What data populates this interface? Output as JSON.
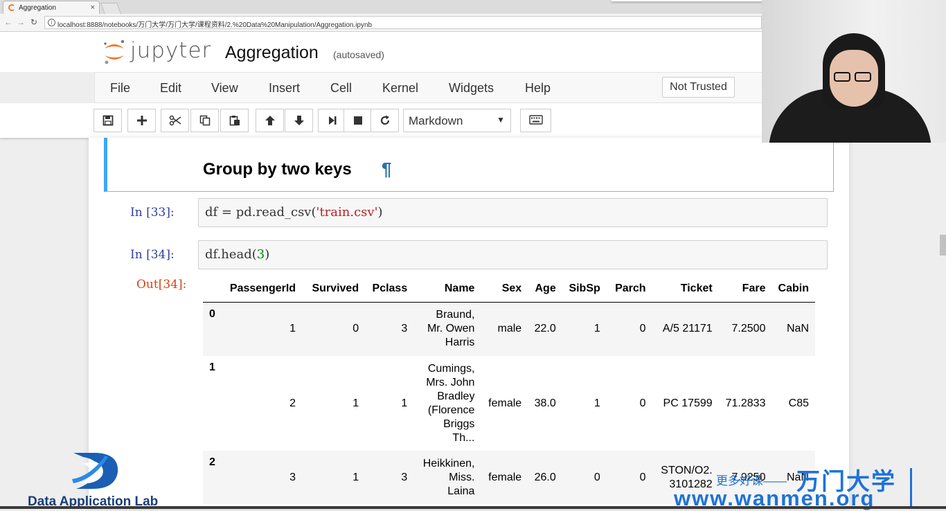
{
  "browser": {
    "tab_title": "Aggregation",
    "tab_close": "×",
    "url": "localhost:8888/notebooks/万门大学/万门大学/课程资料/2.%20Data%20Manipulation/Aggregation.ipynb"
  },
  "header": {
    "logo_text": "jupyter",
    "notebook_title": "Aggregation",
    "autosave_status": "(autosaved)"
  },
  "menu": {
    "items": [
      "File",
      "Edit",
      "View",
      "Insert",
      "Cell",
      "Kernel",
      "Widgets",
      "Help"
    ],
    "trust_label": "Not Trusted"
  },
  "toolbar": {
    "cell_type": "Markdown",
    "icons": [
      "save-icon",
      "plus-icon",
      "scissors-icon",
      "copy-icon",
      "paste-icon",
      "arrow-up-icon",
      "arrow-down-icon",
      "step-forward-icon",
      "stop-icon",
      "restart-icon",
      "keyboard-icon"
    ]
  },
  "cells": {
    "markdown_heading": "Group by two keys",
    "markdown_anchor": "¶",
    "cell1": {
      "prompt": "In  [33]:",
      "code_pre": "df = pd.read_csv(",
      "code_str": "'train.csv'",
      "code_post": ")"
    },
    "cell2": {
      "prompt": "In  [34]:",
      "code_pre": "df.head(",
      "code_num": "3",
      "code_post": ")"
    },
    "output_prompt": "Out[34]:"
  },
  "dataframe": {
    "columns": [
      "",
      "PassengerId",
      "Survived",
      "Pclass",
      "Name",
      "Sex",
      "Age",
      "SibSp",
      "Parch",
      "Ticket",
      "Fare",
      "Cabin"
    ],
    "rows": [
      {
        "index": "0",
        "PassengerId": "1",
        "Survived": "0",
        "Pclass": "3",
        "Name": "Braund, Mr. Owen Harris",
        "Sex": "male",
        "Age": "22.0",
        "SibSp": "1",
        "Parch": "0",
        "Ticket": "A/5 21171",
        "Fare": "7.2500",
        "Cabin": "NaN"
      },
      {
        "index": "1",
        "PassengerId": "2",
        "Survived": "1",
        "Pclass": "1",
        "Name": "Cumings, Mrs. John Bradley (Florence Briggs Th...",
        "Sex": "female",
        "Age": "38.0",
        "SibSp": "1",
        "Parch": "0",
        "Ticket": "PC 17599",
        "Fare": "71.2833",
        "Cabin": "C85"
      },
      {
        "index": "2",
        "PassengerId": "3",
        "Survived": "1",
        "Pclass": "3",
        "Name": "Heikkinen, Miss. Laina",
        "Sex": "female",
        "Age": "26.0",
        "SibSp": "0",
        "Parch": "0",
        "Ticket": "STON/O2. 3101282",
        "Fare": "7.9250",
        "Cabin": "NaN"
      }
    ]
  },
  "watermark": {
    "lab_name": "Data Application Lab",
    "cn_slogan": "更多好课——",
    "cn_brand": "万门大学",
    "url": "www.wanmen.org"
  },
  "colors": {
    "jupyter_orange": "#f37726",
    "prompt_in": "#303f9f",
    "prompt_out": "#d84315",
    "selected_cell": "#42a5f5",
    "watermark_blue": "#1d73d8"
  }
}
